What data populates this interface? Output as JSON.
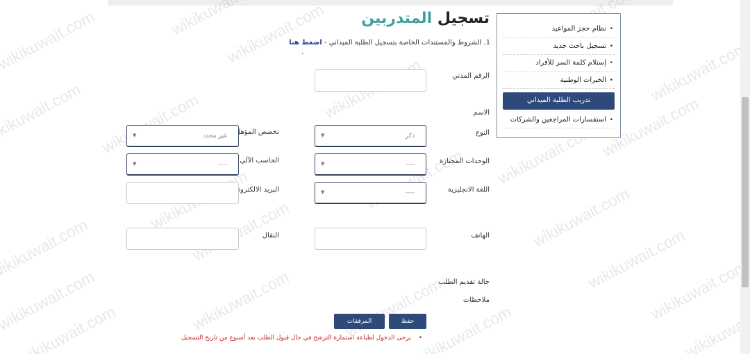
{
  "page": {
    "title_part1": "تسجيل",
    "title_part2": "المتدربين",
    "conditions_text": "1. الشروط والمستندات الخاصة بتسجيل الطلبة الميداني -",
    "conditions_link": "اضغط هنا",
    "note_text": "يرجى الدخول لطباعة استمارة الترشح في حال قبول الطلب بعد أسبوع من تاريخ التسجيل",
    "note_bullet": "•",
    "watermark": "wikikuwait.com"
  },
  "sidebar": {
    "items": [
      {
        "label": "نظام حجز المواعيد",
        "active": false
      },
      {
        "label": "تسجيل باحث جديد",
        "active": false
      },
      {
        "label": "إستلام كلمة السر للأفراد",
        "active": false
      },
      {
        "label": "الخبرات الوطنية",
        "active": false
      },
      {
        "label": "تدريب الطلبة الميداني",
        "active": true
      },
      {
        "label": "استفسارات المراجعين والشركات",
        "active": false
      }
    ],
    "bullet": "•"
  },
  "form": {
    "civil_id_label": "الرقم المدني",
    "name_label": "الاسم",
    "gender_label": "النوع",
    "gender_value": "ذكر",
    "specialization_label": "تخصص المؤهل",
    "specialization_value": "غير محدد",
    "units_label": "الوحدات المجتازة",
    "units_value": "----",
    "computer_label": "الحاسب الآلي",
    "computer_value": "----",
    "english_label": "اللغة الانجليزية",
    "english_value": "----",
    "email_label": "البريد الالكتروني",
    "phone_label": "الهاتف",
    "mobile_label": "النقال",
    "status_label": "حالة تقديم الطلب",
    "notes_label": "ملاحظات",
    "caret": "▼"
  },
  "buttons": {
    "save": "حفظ",
    "attachments": "المرفقات"
  }
}
